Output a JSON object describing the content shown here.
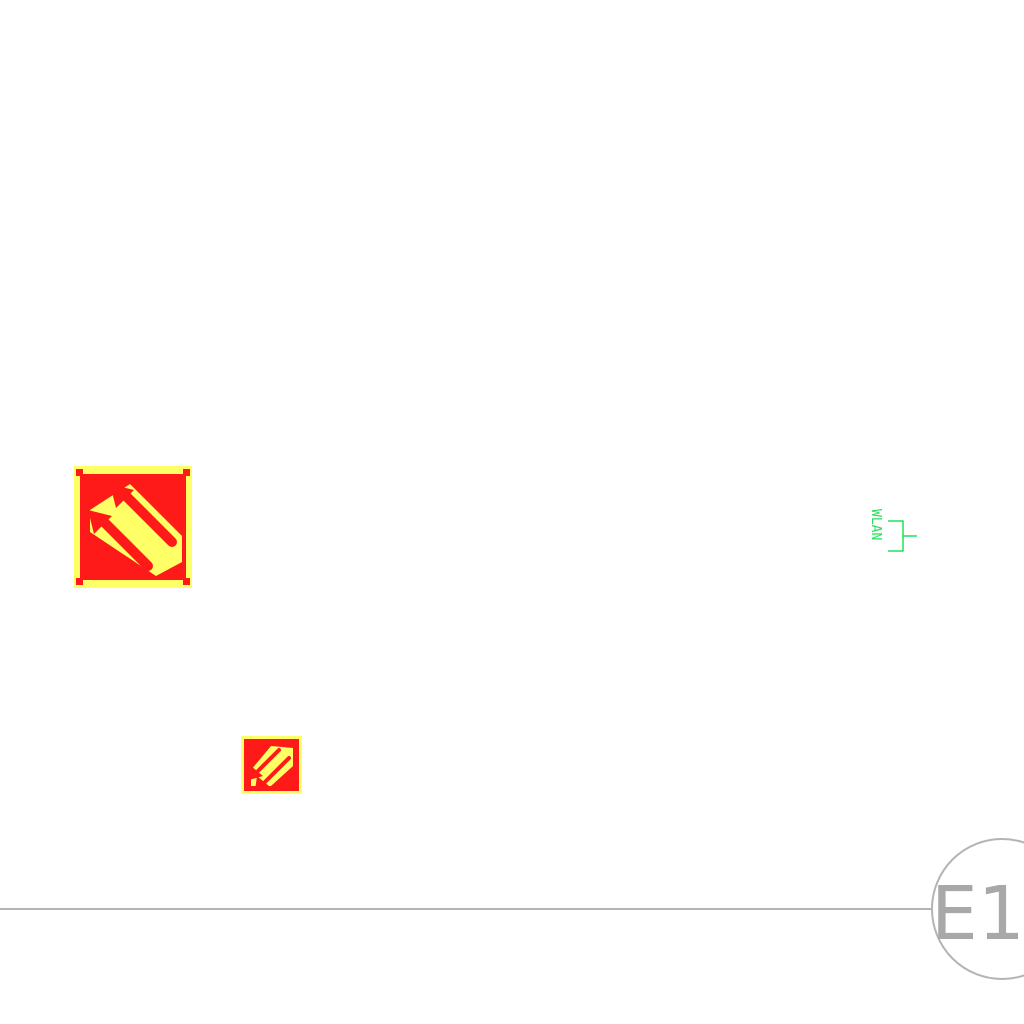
{
  "symbols": {
    "large_sign": {
      "icon": "fire-exit-arrows-icon",
      "border_color": "#ffff66",
      "fill_color": "#ff1a1a",
      "stripe_color": "#ffff66"
    },
    "small_sign": {
      "icon": "fire-exit-arrows-icon",
      "border_color": "#ffff66",
      "fill_color": "#ff1a1a",
      "stripe_color": "#ffff66"
    },
    "access_point": {
      "icon": "wlan-access-point-icon",
      "label": "WLAN",
      "color": "#22e05a"
    }
  },
  "grid": {
    "line_color": "#b4b4b4",
    "bubble_label": "E1",
    "label_color": "#a8a8a8"
  }
}
